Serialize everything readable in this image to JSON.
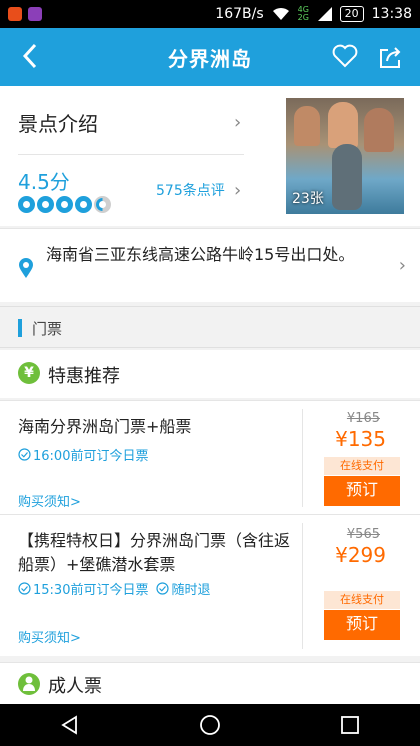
{
  "status_bar": {
    "network_speed": "167B/s",
    "battery": "20",
    "time": "13:38",
    "net_tags": "4G 2G"
  },
  "nav": {
    "title": "分界洲岛"
  },
  "intro": {
    "title": "景点介绍",
    "score": "4.5分",
    "rating": 4.5,
    "reviews": "575条点评",
    "photo_count": "23张"
  },
  "address": {
    "text": "海南省三亚东线高速公路牛岭15号出口处。"
  },
  "section": {
    "label": "门票"
  },
  "categories": [
    {
      "label": "特惠推荐",
      "icon": "yen-icon"
    },
    {
      "label": "成人票",
      "icon": "person-icon"
    }
  ],
  "tickets": [
    {
      "name": "海南分界洲岛门票+船票",
      "tags": [
        "16:00前可订今日票"
      ],
      "notice": "购买须知",
      "original_price": "¥165",
      "price": "¥135",
      "payment": "在线支付",
      "book": "预订"
    },
    {
      "name": "【携程特权日】分界洲岛门票（含往返船票）+堡礁潜水套票",
      "tags": [
        "15:30前可订今日票",
        "随时退"
      ],
      "notice": "购买须知",
      "original_price": "¥565",
      "price": "¥299",
      "payment": "在线支付",
      "book": "预订"
    }
  ],
  "colors": {
    "accent": "#1fa0dc",
    "price": "#ff6a00",
    "category_icon": "#6fbf3b"
  }
}
